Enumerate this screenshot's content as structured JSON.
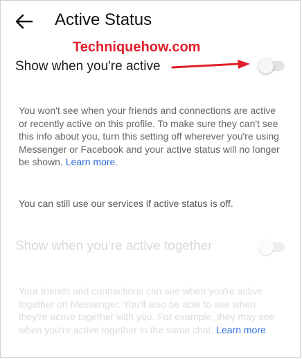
{
  "header": {
    "back_icon": "back-arrow-icon",
    "title": "Active Status"
  },
  "watermark": "Techniquehow.com",
  "active_status": {
    "label": "Show when you're active",
    "enabled": false,
    "description": "You won't see when your friends and connections are active or recently active on this profile. To make sure they can't see this info about you, turn this setting off wherever you're using Messenger or Facebook and your active status will no longer be shown. ",
    "learn_more": "Learn more."
  },
  "note": "You can still use our services if active status is off.",
  "active_together": {
    "label": "Show when you're active together",
    "enabled": false,
    "disabled": true,
    "description": "Your friends and connections can see when you're active together on Messenger. You'll also be able to see when they're active together with you. For example, they may see when you're active together in the same chat. ",
    "learn_more": "Learn more"
  },
  "colors": {
    "link": "#2d6bd8",
    "annotation": "#e0202a"
  }
}
